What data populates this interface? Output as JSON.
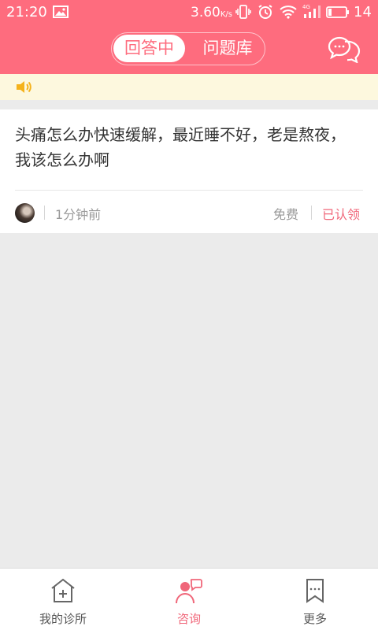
{
  "status_bar": {
    "time": "21:20",
    "net_speed": "3.60",
    "net_unit": "K/s",
    "battery_level": "14",
    "icons": [
      "picture-icon",
      "vibrate-icon",
      "alarm-icon",
      "wifi-icon",
      "signal-4g-icon",
      "battery-icon"
    ]
  },
  "header": {
    "tabs": [
      {
        "label": "回答中",
        "active": true
      },
      {
        "label": "问题库",
        "active": false
      }
    ],
    "icon": "chat-bubbles-icon"
  },
  "notice": {
    "icon": "speaker-icon"
  },
  "question": {
    "text": "头痛怎么办快速缓解，最近睡不好，老是熬夜，我该怎么办啊",
    "time_ago": "1分钟前",
    "price": "免费",
    "status": "已认领"
  },
  "tab_bar": {
    "items": [
      {
        "label": "我的诊所",
        "icon": "clinic-home-icon",
        "active": false
      },
      {
        "label": "咨询",
        "icon": "consult-icon",
        "active": true
      },
      {
        "label": "更多",
        "icon": "bookmark-more-icon",
        "active": false
      }
    ]
  },
  "colors": {
    "brand": "#fe6c7e",
    "accent_text": "#f0677a",
    "notice_bg": "#fdf8de",
    "page_bg": "#ebebeb"
  }
}
